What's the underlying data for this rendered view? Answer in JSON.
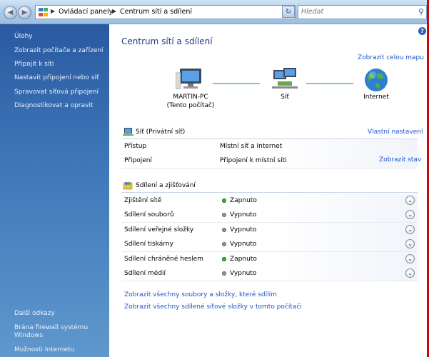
{
  "address_bar": {
    "crumbs": [
      "Ovládací panely",
      "Centrum sítí a sdílení"
    ]
  },
  "search": {
    "placeholder": "Hledat"
  },
  "sidebar": {
    "tasks": [
      {
        "label": "Úlohy"
      },
      {
        "label": "Zobrazit počítače a zařízení"
      },
      {
        "label": "Připojit k síti"
      },
      {
        "label": "Nastavit připojení nebo síť"
      },
      {
        "label": "Spravovat síťová připojení"
      },
      {
        "label": "Diagnostikovat a opravit"
      }
    ],
    "more_links_heading": "Další odkazy",
    "more_links": [
      {
        "label_line1": "Brána firewall systému",
        "label_line2": "Windows"
      },
      {
        "label": "Možnosti Internetu"
      }
    ]
  },
  "main": {
    "title": "Centrum sítí a sdílení",
    "view_full_map": "Zobrazit celou mapu",
    "map": {
      "computer_name": "MARTIN-PC",
      "computer_sub": "(Tento počítač)",
      "network": "Síť",
      "internet": "Internet"
    },
    "network_section": {
      "title": "Síť (Privátní síť)",
      "customize": "Vlastní nastavení",
      "rows": [
        {
          "key": "Přístup",
          "value": "Místní síť a Internet",
          "link": ""
        },
        {
          "key": "Připojení",
          "value": "Připojení k místní síti",
          "link": "Zobrazit stav"
        }
      ]
    },
    "sharing_section": {
      "title": "Sdílení a zjišťování",
      "rows": [
        {
          "key": "Zjištění sítě",
          "status": "Zapnuto",
          "on": true
        },
        {
          "key": "Sdílení souborů",
          "status": "Vypnuto",
          "on": false
        },
        {
          "key": "Sdílení veřejné složky",
          "status": "Vypnuto",
          "on": false
        },
        {
          "key": "Sdílení tiskárny",
          "status": "Vypnuto",
          "on": false
        },
        {
          "key": "Sdílení chráněné heslem",
          "status": "Zapnuto",
          "on": true
        },
        {
          "key": "Sdílení médií",
          "status": "Vypnuto",
          "on": false
        }
      ]
    },
    "bottom_links": [
      "Zobrazit všechny soubory a složky, které sdílím",
      "Zobrazit všechny sdílené síťové složky v tomto počítači"
    ]
  },
  "colors": {
    "link": "#1f56c7",
    "title": "#1e3a8a",
    "on": "#34b22f",
    "off": "#8e9196",
    "sidebar": "#3d76b8"
  }
}
